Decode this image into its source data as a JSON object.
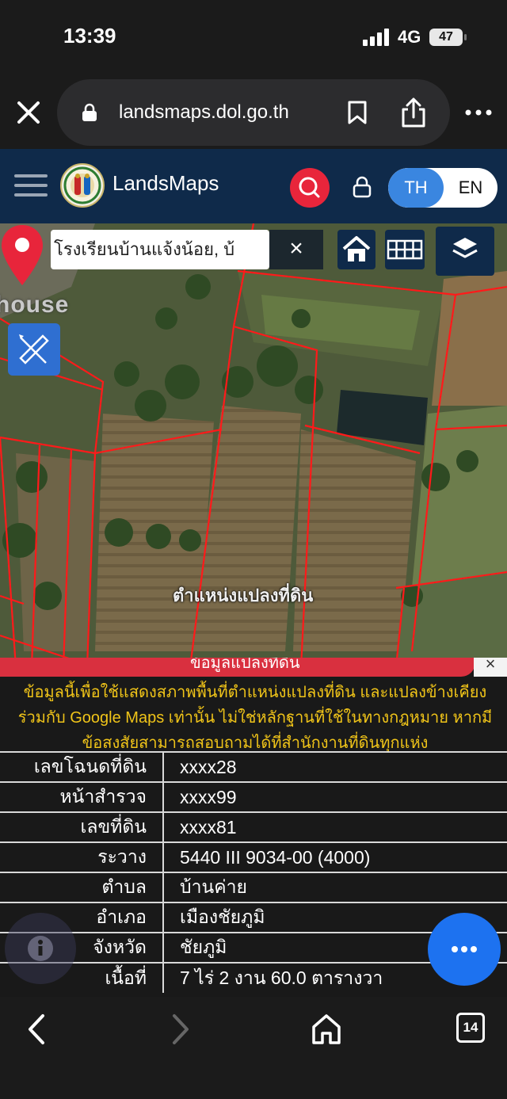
{
  "status_bar": {
    "time": "13:39",
    "network": "4G",
    "battery": "47"
  },
  "browser": {
    "url": "landsmaps.dol.go.th"
  },
  "app_header": {
    "brand": "LandsMaps",
    "lang_th": "TH",
    "lang_en": "EN",
    "accent": "#e8253b",
    "header_bg": "#0f2a4a"
  },
  "map": {
    "search_value": "โรงเรียนบ้านแจ้งน้อย, บ้",
    "clear_symbol": "×",
    "place_label": "house",
    "pin_label": "ตำแหน่งแปลงที่ดิน",
    "pin_color": "#e8253b"
  },
  "panel": {
    "title": "ข้อมูลแปลงที่ดิน",
    "close_symbol": "×",
    "disclaimer": "ข้อมูลนี้เพื่อใช้แสดงสภาพพื้นที่ตำแหน่งแปลงที่ดิน และแปลงข้างเคียง ร่วมกับ Google Maps เท่านั้น ไม่ใช่หลักฐานที่ใช้ในทางกฎหมาย หากมีข้อสงสัยสามารถสอบถามได้ที่สำนักงานที่ดินทุกแห่ง",
    "rows": [
      {
        "key": "เลขโฉนดที่ดิน",
        "value": "xxxx28"
      },
      {
        "key": "หน้าสำรวจ",
        "value": "xxxx99"
      },
      {
        "key": "เลขที่ดิน",
        "value": "xxxx81"
      },
      {
        "key": "ระวาง",
        "value": "5440 III 9034-00 (4000)"
      },
      {
        "key": "ตำบล",
        "value": "บ้านค่าย"
      },
      {
        "key": "อำเภอ",
        "value": "เมืองชัยภูมิ"
      },
      {
        "key": "จังหวัด",
        "value": "ชัยภูมิ"
      },
      {
        "key": "เนื้อที่",
        "value": "7 ไร่ 2 งาน 60.0 ตารางวา"
      }
    ],
    "info_icon": "info-icon",
    "chat_icon": "chat-more-icon"
  },
  "bottom_bar": {
    "tab_count": "14"
  }
}
